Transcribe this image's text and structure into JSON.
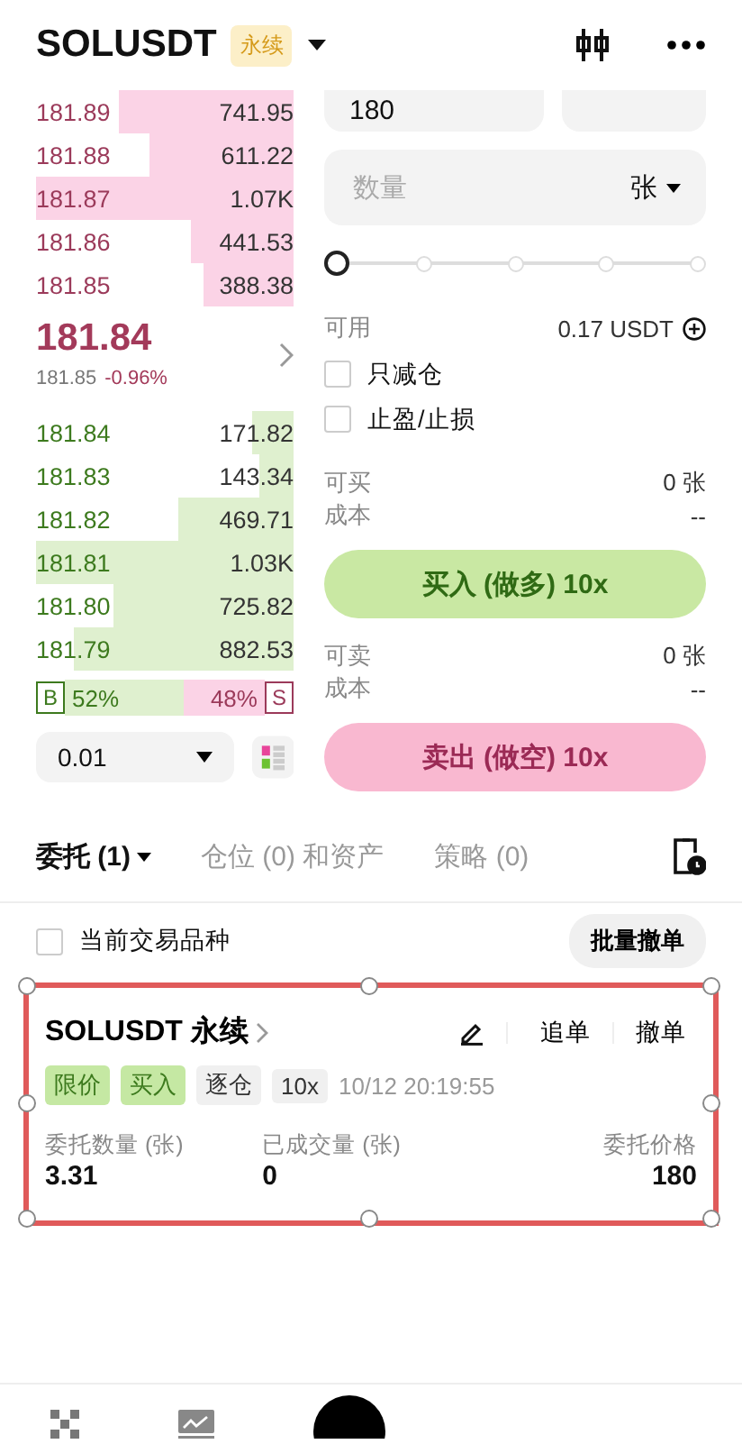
{
  "header": {
    "symbol": "SOLUSDT",
    "badge": "永续"
  },
  "order_book": {
    "asks": [
      {
        "price": "181.89",
        "amount": "741.95",
        "level": 0.68
      },
      {
        "price": "181.88",
        "amount": "611.22",
        "level": 0.56
      },
      {
        "price": "181.87",
        "amount": "1.07K",
        "level": 1
      },
      {
        "price": "181.86",
        "amount": "441.53",
        "level": 0.4
      },
      {
        "price": "181.85",
        "amount": "388.38",
        "level": 0.35
      }
    ],
    "last_price": "181.84",
    "mark_price": "181.85",
    "change": "-0.96%",
    "bids": [
      {
        "price": "181.84",
        "amount": "171.82",
        "level": 0.16
      },
      {
        "price": "181.83",
        "amount": "143.34",
        "level": 0.13
      },
      {
        "price": "181.82",
        "amount": "469.71",
        "level": 0.45
      },
      {
        "price": "181.81",
        "amount": "1.03K",
        "level": 1
      },
      {
        "price": "181.80",
        "amount": "725.82",
        "level": 0.7
      },
      {
        "price": "181.79",
        "amount": "882.53",
        "level": 0.85
      }
    ],
    "ratio": {
      "buy_tag": "B",
      "buy_pct": "52%",
      "sell_pct": "48%",
      "sell_tag": "S",
      "level": 0.52
    },
    "precision": "0.01"
  },
  "form": {
    "price_value": "180",
    "quantity_placeholder": "数量",
    "unit": "张",
    "slider": {
      "level": 0
    },
    "available_label": "可用",
    "available_value": "0.17 USDT",
    "options": [
      {
        "label": "只减仓",
        "checked": false
      },
      {
        "label": "止盈/止损",
        "checked": false
      }
    ],
    "buy_info": [
      {
        "label": "可买",
        "value": "0 张"
      },
      {
        "label": "成本",
        "value": "--"
      }
    ],
    "buy_button": "买入 (做多) 10x",
    "sell_info": [
      {
        "label": "可卖",
        "value": "0 张"
      },
      {
        "label": "成本",
        "value": "--"
      }
    ],
    "sell_button": "卖出 (做空) 10x"
  },
  "tabs": [
    {
      "label": "委托 (1)",
      "selected": true
    },
    {
      "label": "仓位 (0) 和资产",
      "selected": false
    },
    {
      "label": "策略 (0)",
      "selected": false
    }
  ],
  "filter": {
    "label": "当前交易品种",
    "checked": false,
    "button": "批量撤单"
  },
  "orders": [
    {
      "symbol": "SOLUSDT 永续",
      "highlighted": true,
      "actions": [
        "追单",
        "撤单"
      ],
      "tags": [
        {
          "text": "限价",
          "kind": "accent"
        },
        {
          "text": "买入",
          "kind": "accent"
        },
        {
          "text": "逐仓",
          "kind": "plain"
        },
        {
          "text": "10x",
          "kind": "plain"
        }
      ],
      "time": "10/12 20:19:55",
      "fields": [
        {
          "label": "委托数量 (张)",
          "value": "3.31"
        },
        {
          "label": "已成交量 (张)",
          "value": "0"
        },
        {
          "label": "委托价格",
          "value": "180"
        }
      ]
    }
  ]
}
